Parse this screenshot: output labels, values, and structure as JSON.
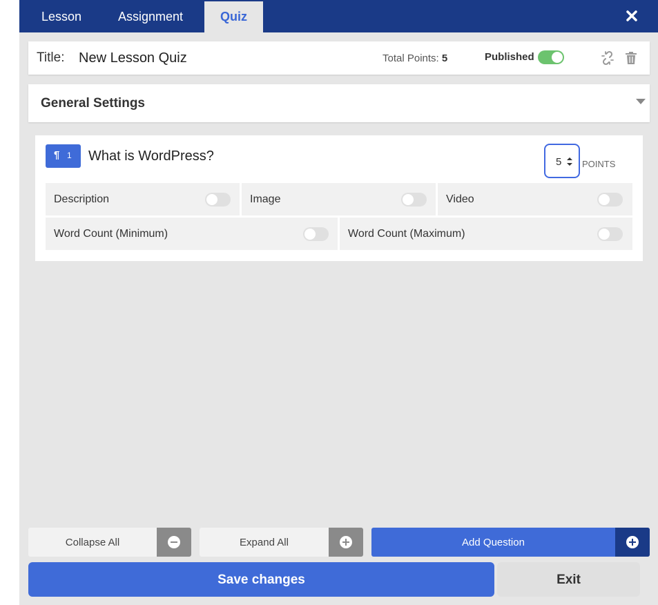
{
  "tabs": [
    {
      "label": "Lesson"
    },
    {
      "label": "Assignment"
    },
    {
      "label": "Quiz"
    }
  ],
  "colors": {
    "accent": "#3f6bd8",
    "dark_blue": "#1a3a87",
    "toggle_on": "#6cc36e"
  },
  "header": {
    "title_label": "Title:",
    "title_value": "New Lesson Quiz",
    "total_points_label": "Total Points:",
    "total_points_value": "5",
    "published_label": "Published",
    "published_on": true
  },
  "general_settings": {
    "label": "General Settings"
  },
  "question": {
    "number": "1",
    "title": "What is WordPress?",
    "points_value": "5",
    "points_label": "POINTS",
    "options": [
      {
        "label": "Description"
      },
      {
        "label": "Image"
      },
      {
        "label": "Video"
      },
      {
        "label": "Word Count (Minimum)"
      },
      {
        "label": "Word Count (Maximum)"
      }
    ]
  },
  "footer": {
    "collapse_all": "Collapse All",
    "expand_all": "Expand All",
    "add_question": "Add Question",
    "save_changes": "Save changes",
    "exit": "Exit"
  },
  "icons": [
    "close-icon",
    "unlink-icon",
    "trash-icon",
    "chevron-down-icon",
    "paragraph-icon",
    "spinner-arrows-icon",
    "minus-circle-icon",
    "plus-circle-icon"
  ]
}
